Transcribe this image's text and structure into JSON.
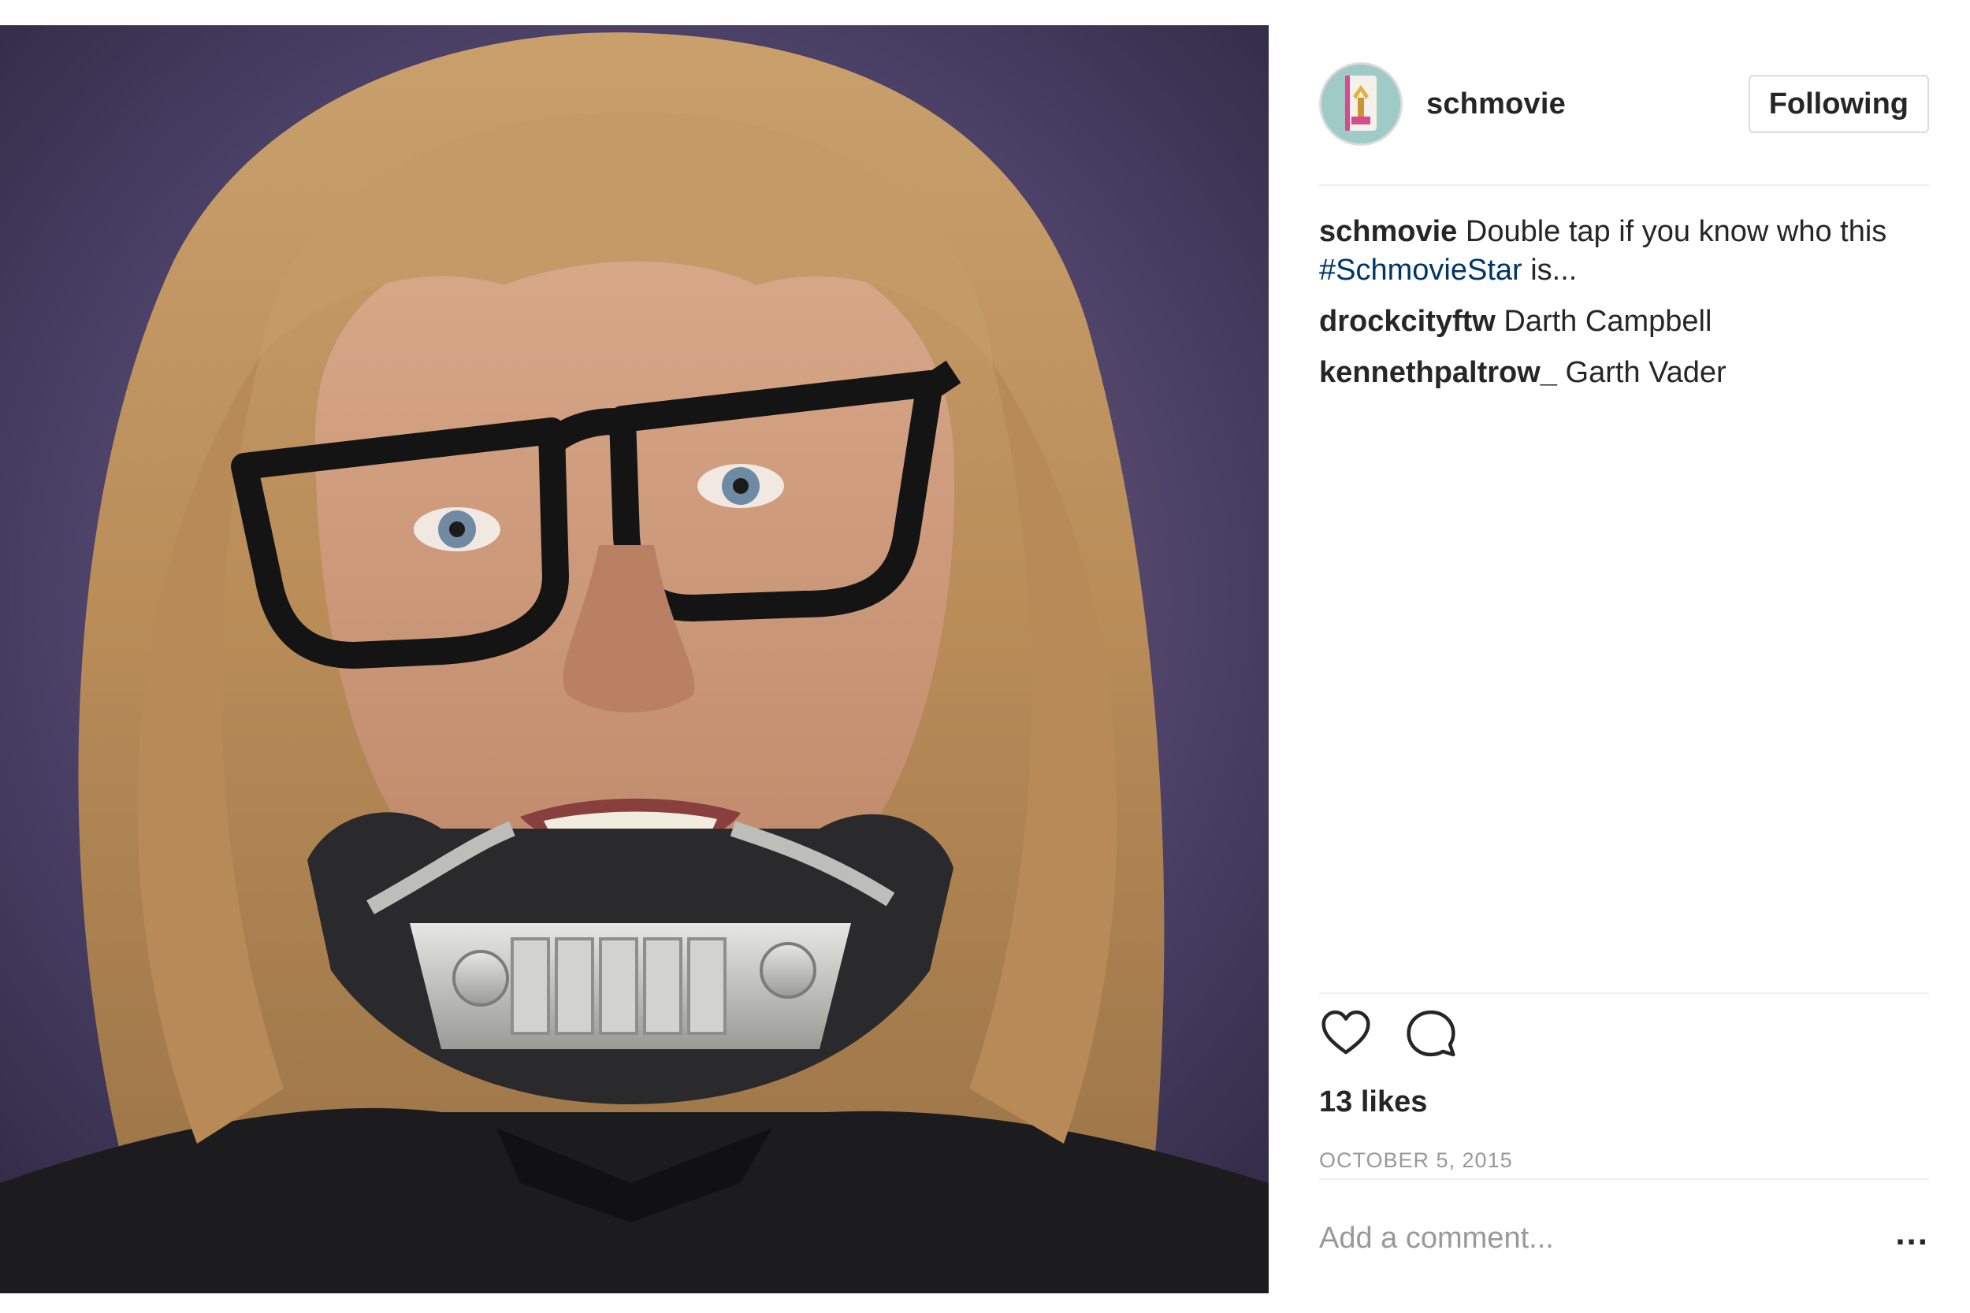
{
  "post": {
    "username": "schmovie",
    "follow_label": "Following",
    "caption": {
      "user": "schmovie",
      "text_before": "Double tap if you know who this",
      "hashtag": "#SchmovieStar",
      "text_after": " is..."
    },
    "comments": [
      {
        "user": "drockcityftw",
        "text": "Darth Campbell"
      },
      {
        "user": "kennethpaltrow_",
        "text": "Garth Vader"
      }
    ],
    "likes": "13 likes",
    "date": "OCTOBER 5, 2015",
    "comment_placeholder": "Add a comment...",
    "more_label": "..."
  },
  "icons": {
    "like": "heart-icon",
    "comment": "speech-bubble-icon",
    "more": "ellipsis-icon"
  },
  "colors": {
    "hashtag": "#003569",
    "text": "#262626",
    "muted": "#999999",
    "border": "#dbdbdb"
  }
}
